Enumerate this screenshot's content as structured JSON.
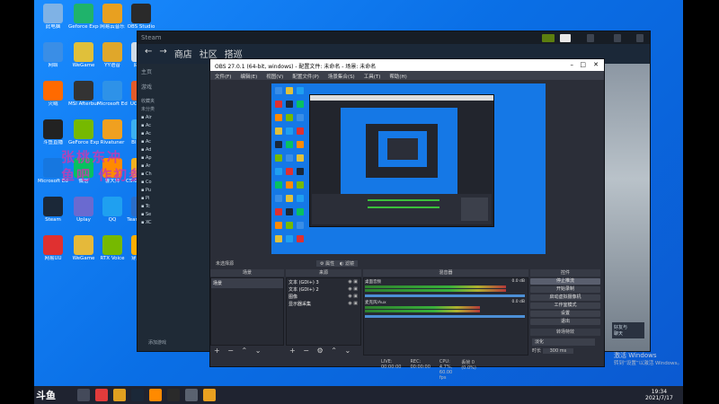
{
  "desktop": {
    "icons": [
      {
        "label": "此电脑",
        "color": "#7fb2e5"
      },
      {
        "label": "Geforce Experience",
        "color": "#1fb36b"
      },
      {
        "label": "网易云音乐",
        "color": "#e8a020"
      },
      {
        "label": "OBS Studio",
        "color": "#2a2a2a"
      },
      {
        "label": "网络",
        "color": "#3a8ee6"
      },
      {
        "label": "WeGame",
        "color": "#e0c03a"
      },
      {
        "label": "YY语音",
        "color": "#e0a72a"
      },
      {
        "label": "回收站",
        "color": "#d0dce8"
      },
      {
        "label": "火绒",
        "color": "#ff6a00"
      },
      {
        "label": "MSI Afterburner",
        "color": "#333"
      },
      {
        "label": "Microsoft Edge",
        "color": "#2e92e8"
      },
      {
        "label": "UC浏览器",
        "color": "#e35b2a"
      },
      {
        "label": "斗鱼直播",
        "color": "#222"
      },
      {
        "label": "GeForce Experience",
        "color": "#76b900"
      },
      {
        "label": "Rivatuner",
        "color": "#f0a020"
      },
      {
        "label": "Blizzard",
        "color": "#3bb0f0"
      },
      {
        "label": "Microsoft Edge",
        "color": "#1677e0"
      },
      {
        "label": "微信",
        "color": "#07c160"
      },
      {
        "label": "鲁大师",
        "color": "#ff8a00"
      },
      {
        "label": "CS:GO Steam",
        "color": "#f0b020"
      },
      {
        "label": "Steam",
        "color": "#1b2838"
      },
      {
        "label": "Uplay",
        "color": "#6a6ad0"
      },
      {
        "label": "QQ",
        "color": "#1fa0f0"
      },
      {
        "label": "TeamSpeak",
        "color": "#2b6ec9"
      },
      {
        "label": "网易UU",
        "color": "#e03030"
      },
      {
        "label": "WeGame",
        "color": "#e5b93a"
      },
      {
        "label": "RTX Voice",
        "color": "#76b900"
      },
      {
        "label": "穿越火线",
        "color": "#ffae00"
      }
    ],
    "watermark_line1": "张桃东冲",
    "watermark_line2": "鱼吧 作初参详"
  },
  "steam": {
    "top_label": "Steam",
    "nav": [
      "商店",
      "社区",
      "搭巡"
    ],
    "sidebar": [
      "主页",
      "游戏",
      "收藏夹",
      "未分类"
    ],
    "list_items": [
      "Air",
      "Ac",
      "Ac",
      "Ac",
      "Ad",
      "Ap",
      "Ar",
      "Ch",
      "Co",
      "Pu",
      "Pi",
      "Tc",
      "Se",
      "XC"
    ],
    "bottom_left": "添加游戏",
    "bottom_right": "好友与\n聊天"
  },
  "obs": {
    "title": "OBS 27.0.1 (64-bit, windows) - 配置文件: 未命名 - 场景: 未命名",
    "menu": [
      "文件(F)",
      "编辑(E)",
      "视图(V)",
      "配置文件(P)",
      "场景集合(S)",
      "工具(T)",
      "帮助(H)"
    ],
    "no_source_label": "未选择源",
    "props_button": "属性",
    "filters_button": "滤镜",
    "docks": {
      "scenes": "场景",
      "sources": "来源",
      "mixer": "混音器",
      "transitions": "转场特效",
      "controls": "控件"
    },
    "scene_items": [
      "场景"
    ],
    "source_items": [
      "文本 (GDI+) 3",
      "文本 (GDI+) 2",
      "图像",
      "显示器采集"
    ],
    "mixer_tracks": [
      {
        "name": "桌面音频",
        "level_db": "0.0 dB",
        "level": 0.88
      },
      {
        "name": "麦克风/Aux",
        "level_db": "0.0 dB",
        "level": 0.72
      }
    ],
    "controls": [
      "停止推流",
      "开始录制",
      "启动虚拟摄像机",
      "工作室模式",
      "设置",
      "退出"
    ],
    "transition": {
      "label": "淡化",
      "duration_label": "时长",
      "duration": "300 ms"
    },
    "status": [
      "LIVE: 00:00:00",
      "REC: 00:00:00",
      "CPU: 4.7%, 60.00 fps"
    ],
    "status_right": "丢帧 0 (0.0%)"
  },
  "taskbar": {
    "time": "19:34",
    "date": "2021/7/17",
    "left_brand": "斗鱼"
  },
  "activation": {
    "title": "激活 Windows",
    "subtitle": "转到“设置”以激活 Windows。"
  }
}
